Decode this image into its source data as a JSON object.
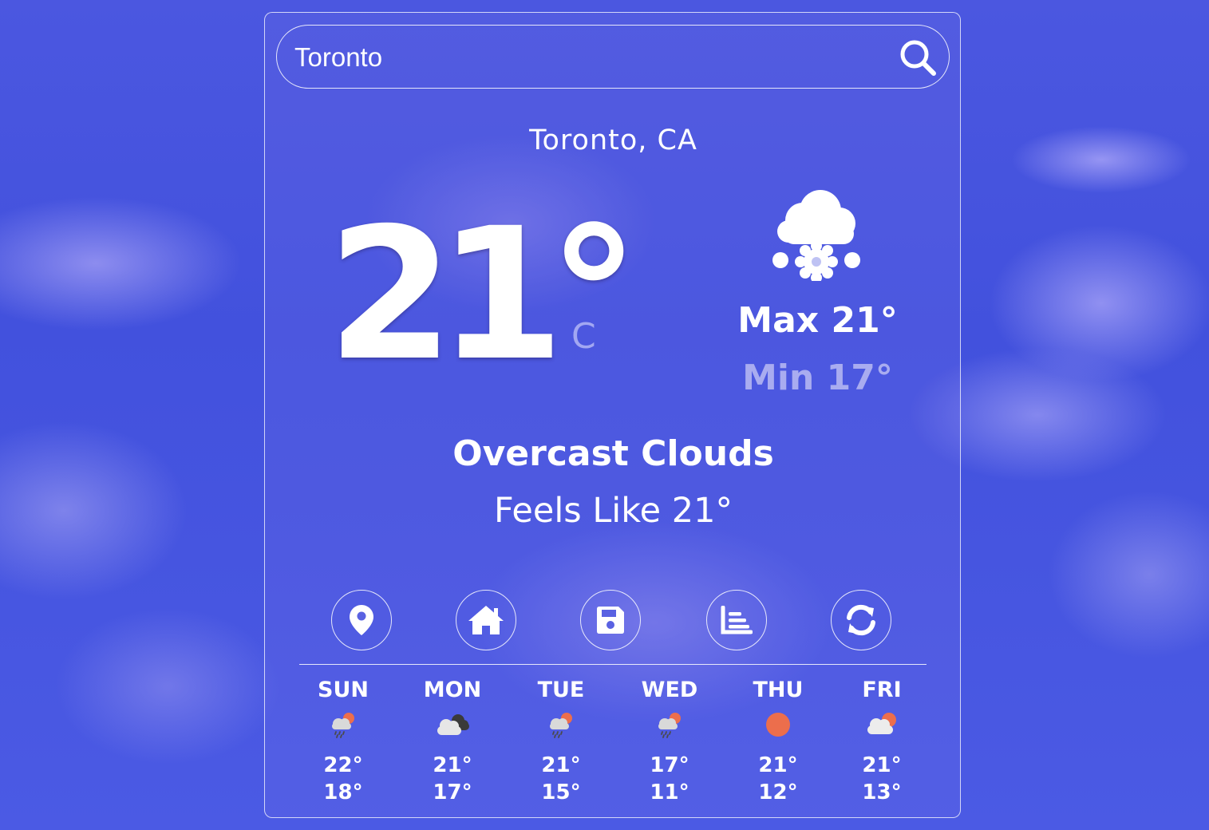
{
  "search": {
    "value": "Toronto",
    "icon": "search-icon"
  },
  "current": {
    "location": "Toronto, CA",
    "temperature": "21°",
    "unit": "C",
    "icon": "cloud-snow-icon",
    "max": "Max 21°",
    "min": "Min 17°",
    "description": "Overcast Clouds",
    "feels_like": "Feels Like 21°"
  },
  "actions": [
    {
      "icon": "location-pin-icon"
    },
    {
      "icon": "home-icon"
    },
    {
      "icon": "save-icon"
    },
    {
      "icon": "chart-icon"
    },
    {
      "icon": "refresh-icon"
    }
  ],
  "forecast": [
    {
      "day": "SUN",
      "hi": "22°",
      "lo": "18°",
      "icon": "rain-cloud-sun-icon"
    },
    {
      "day": "MON",
      "hi": "21°",
      "lo": "17°",
      "icon": "broken-clouds-icon"
    },
    {
      "day": "TUE",
      "hi": "21°",
      "lo": "15°",
      "icon": "rain-cloud-sun-icon"
    },
    {
      "day": "WED",
      "hi": "17°",
      "lo": "11°",
      "icon": "rain-cloud-sun-icon"
    },
    {
      "day": "THU",
      "hi": "21°",
      "lo": "12°",
      "icon": "sun-icon"
    },
    {
      "day": "FRI",
      "hi": "21°",
      "lo": "13°",
      "icon": "cloud-sun-icon"
    }
  ],
  "colors": {
    "sun": "#ec6e4c",
    "cloud_dark": "#3a3a3a",
    "cloud_light": "#e6e6e6"
  }
}
